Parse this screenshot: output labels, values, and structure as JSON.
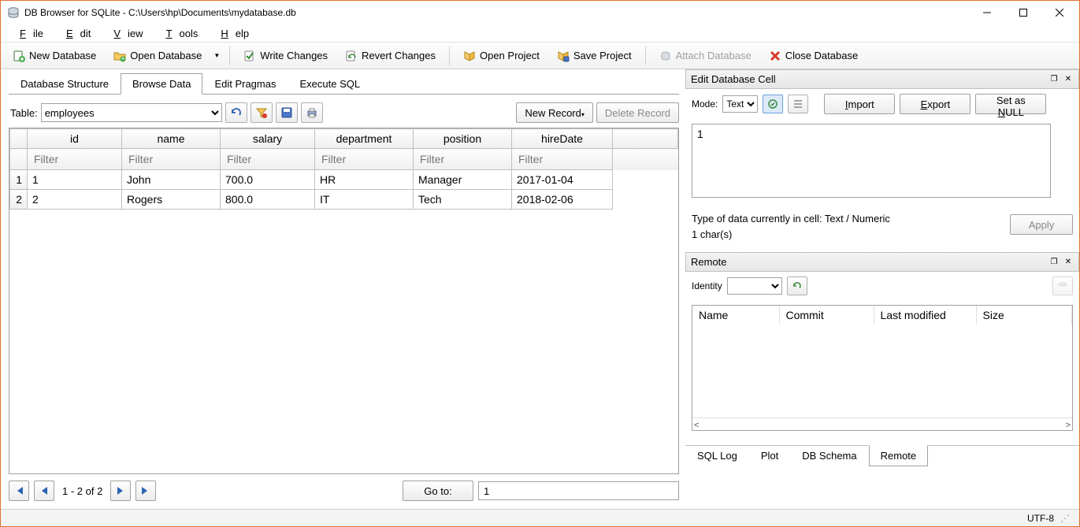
{
  "title": "DB Browser for SQLite - C:\\Users\\hp\\Documents\\mydatabase.db",
  "menu": {
    "file": "File",
    "edit": "Edit",
    "view": "View",
    "tools": "Tools",
    "help": "Help"
  },
  "toolbar": {
    "new_db": "New Database",
    "open_db": "Open Database",
    "write": "Write Changes",
    "revert": "Revert Changes",
    "open_project": "Open Project",
    "save_project": "Save Project",
    "attach": "Attach Database",
    "close": "Close Database"
  },
  "tabs": {
    "struct": "Database Structure",
    "browse": "Browse Data",
    "pragmas": "Edit Pragmas",
    "sql": "Execute SQL"
  },
  "browse": {
    "table_label": "Table:",
    "table_selected": "employees",
    "new_record": "New Record",
    "delete_record": "Delete Record",
    "columns": [
      "id",
      "name",
      "salary",
      "department",
      "position",
      "hireDate"
    ],
    "filter_placeholder": "Filter",
    "rows": [
      {
        "n": "1",
        "id": "1",
        "name": "John",
        "salary": "700.0",
        "department": "HR",
        "position": "Manager",
        "hireDate": "2017-01-04"
      },
      {
        "n": "2",
        "id": "2",
        "name": "Rogers",
        "salary": "800.0",
        "department": "IT",
        "position": "Tech",
        "hireDate": "2018-02-06"
      }
    ],
    "nav_status": "1 - 2 of 2",
    "goto_label": "Go to:",
    "goto_value": "1"
  },
  "edit_cell": {
    "title": "Edit Database Cell",
    "mode_label": "Mode:",
    "mode_value": "Text",
    "import": "Import",
    "export": "Export",
    "set_null": "Set as NULL",
    "value": "1",
    "type_line": "Type of data currently in cell: Text / Numeric",
    "chars_line": "1 char(s)",
    "apply": "Apply"
  },
  "remote": {
    "title": "Remote",
    "identity_label": "Identity",
    "cols": {
      "name": "Name",
      "commit": "Commit",
      "last_modified": "Last modified",
      "size": "Size"
    }
  },
  "bottom_tabs": {
    "sql_log": "SQL Log",
    "plot": "Plot",
    "schema": "DB Schema",
    "remote": "Remote"
  },
  "status": {
    "encoding": "UTF-8"
  }
}
